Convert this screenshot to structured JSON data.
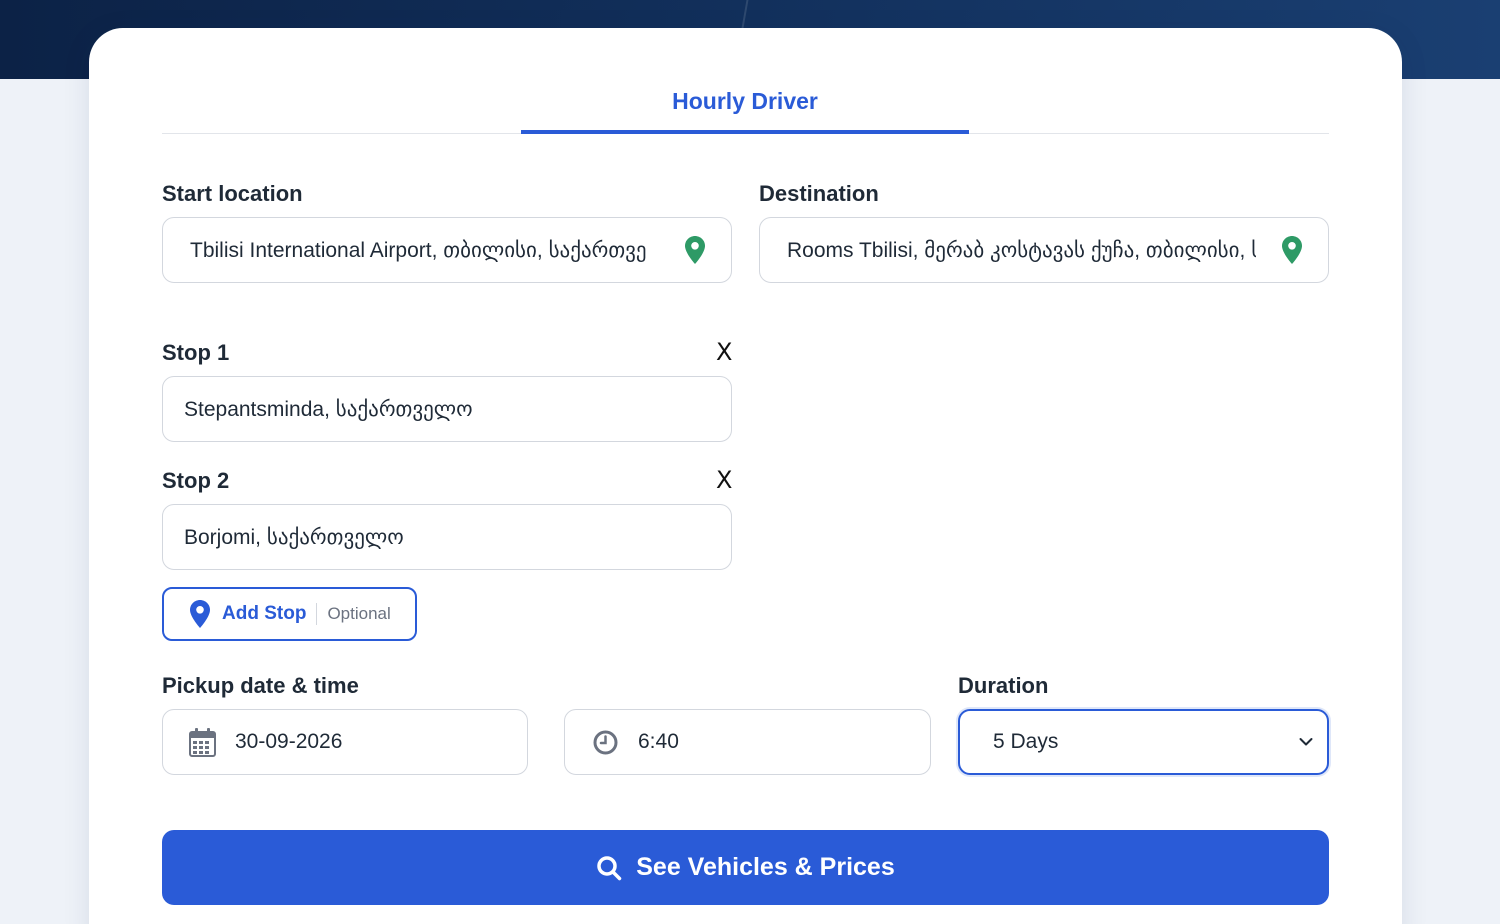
{
  "tabs": [
    {
      "label": "Hourly Driver",
      "active": true
    }
  ],
  "start": {
    "label": "Start location",
    "value": "Tbilisi International Airport, თბილისი, საქართვე"
  },
  "destination": {
    "label": "Destination",
    "value": "Rooms Tbilisi, მერაბ კოსტავას ქუჩა, თბილისი, ს"
  },
  "stops": [
    {
      "label": "Stop 1",
      "value": "Stepantsminda, საქართველო",
      "remove": "X"
    },
    {
      "label": "Stop 2",
      "value": "Borjomi, საქართველო",
      "remove": "X"
    }
  ],
  "add_stop": {
    "label": "Add Stop",
    "hint": "Optional"
  },
  "pickup": {
    "label": "Pickup date & time",
    "date": "30-09-2026",
    "time": "6:40"
  },
  "duration": {
    "label": "Duration",
    "value": "5 Days"
  },
  "submit": {
    "label": "See Vehicles & Prices"
  },
  "colors": {
    "accent": "#2a5bd7",
    "pin": "#2e9a66",
    "header": "#0c2246"
  },
  "icons": [
    "map-pin-icon",
    "close-icon",
    "calendar-icon",
    "clock-icon",
    "chevron-down-icon",
    "search-icon"
  ]
}
